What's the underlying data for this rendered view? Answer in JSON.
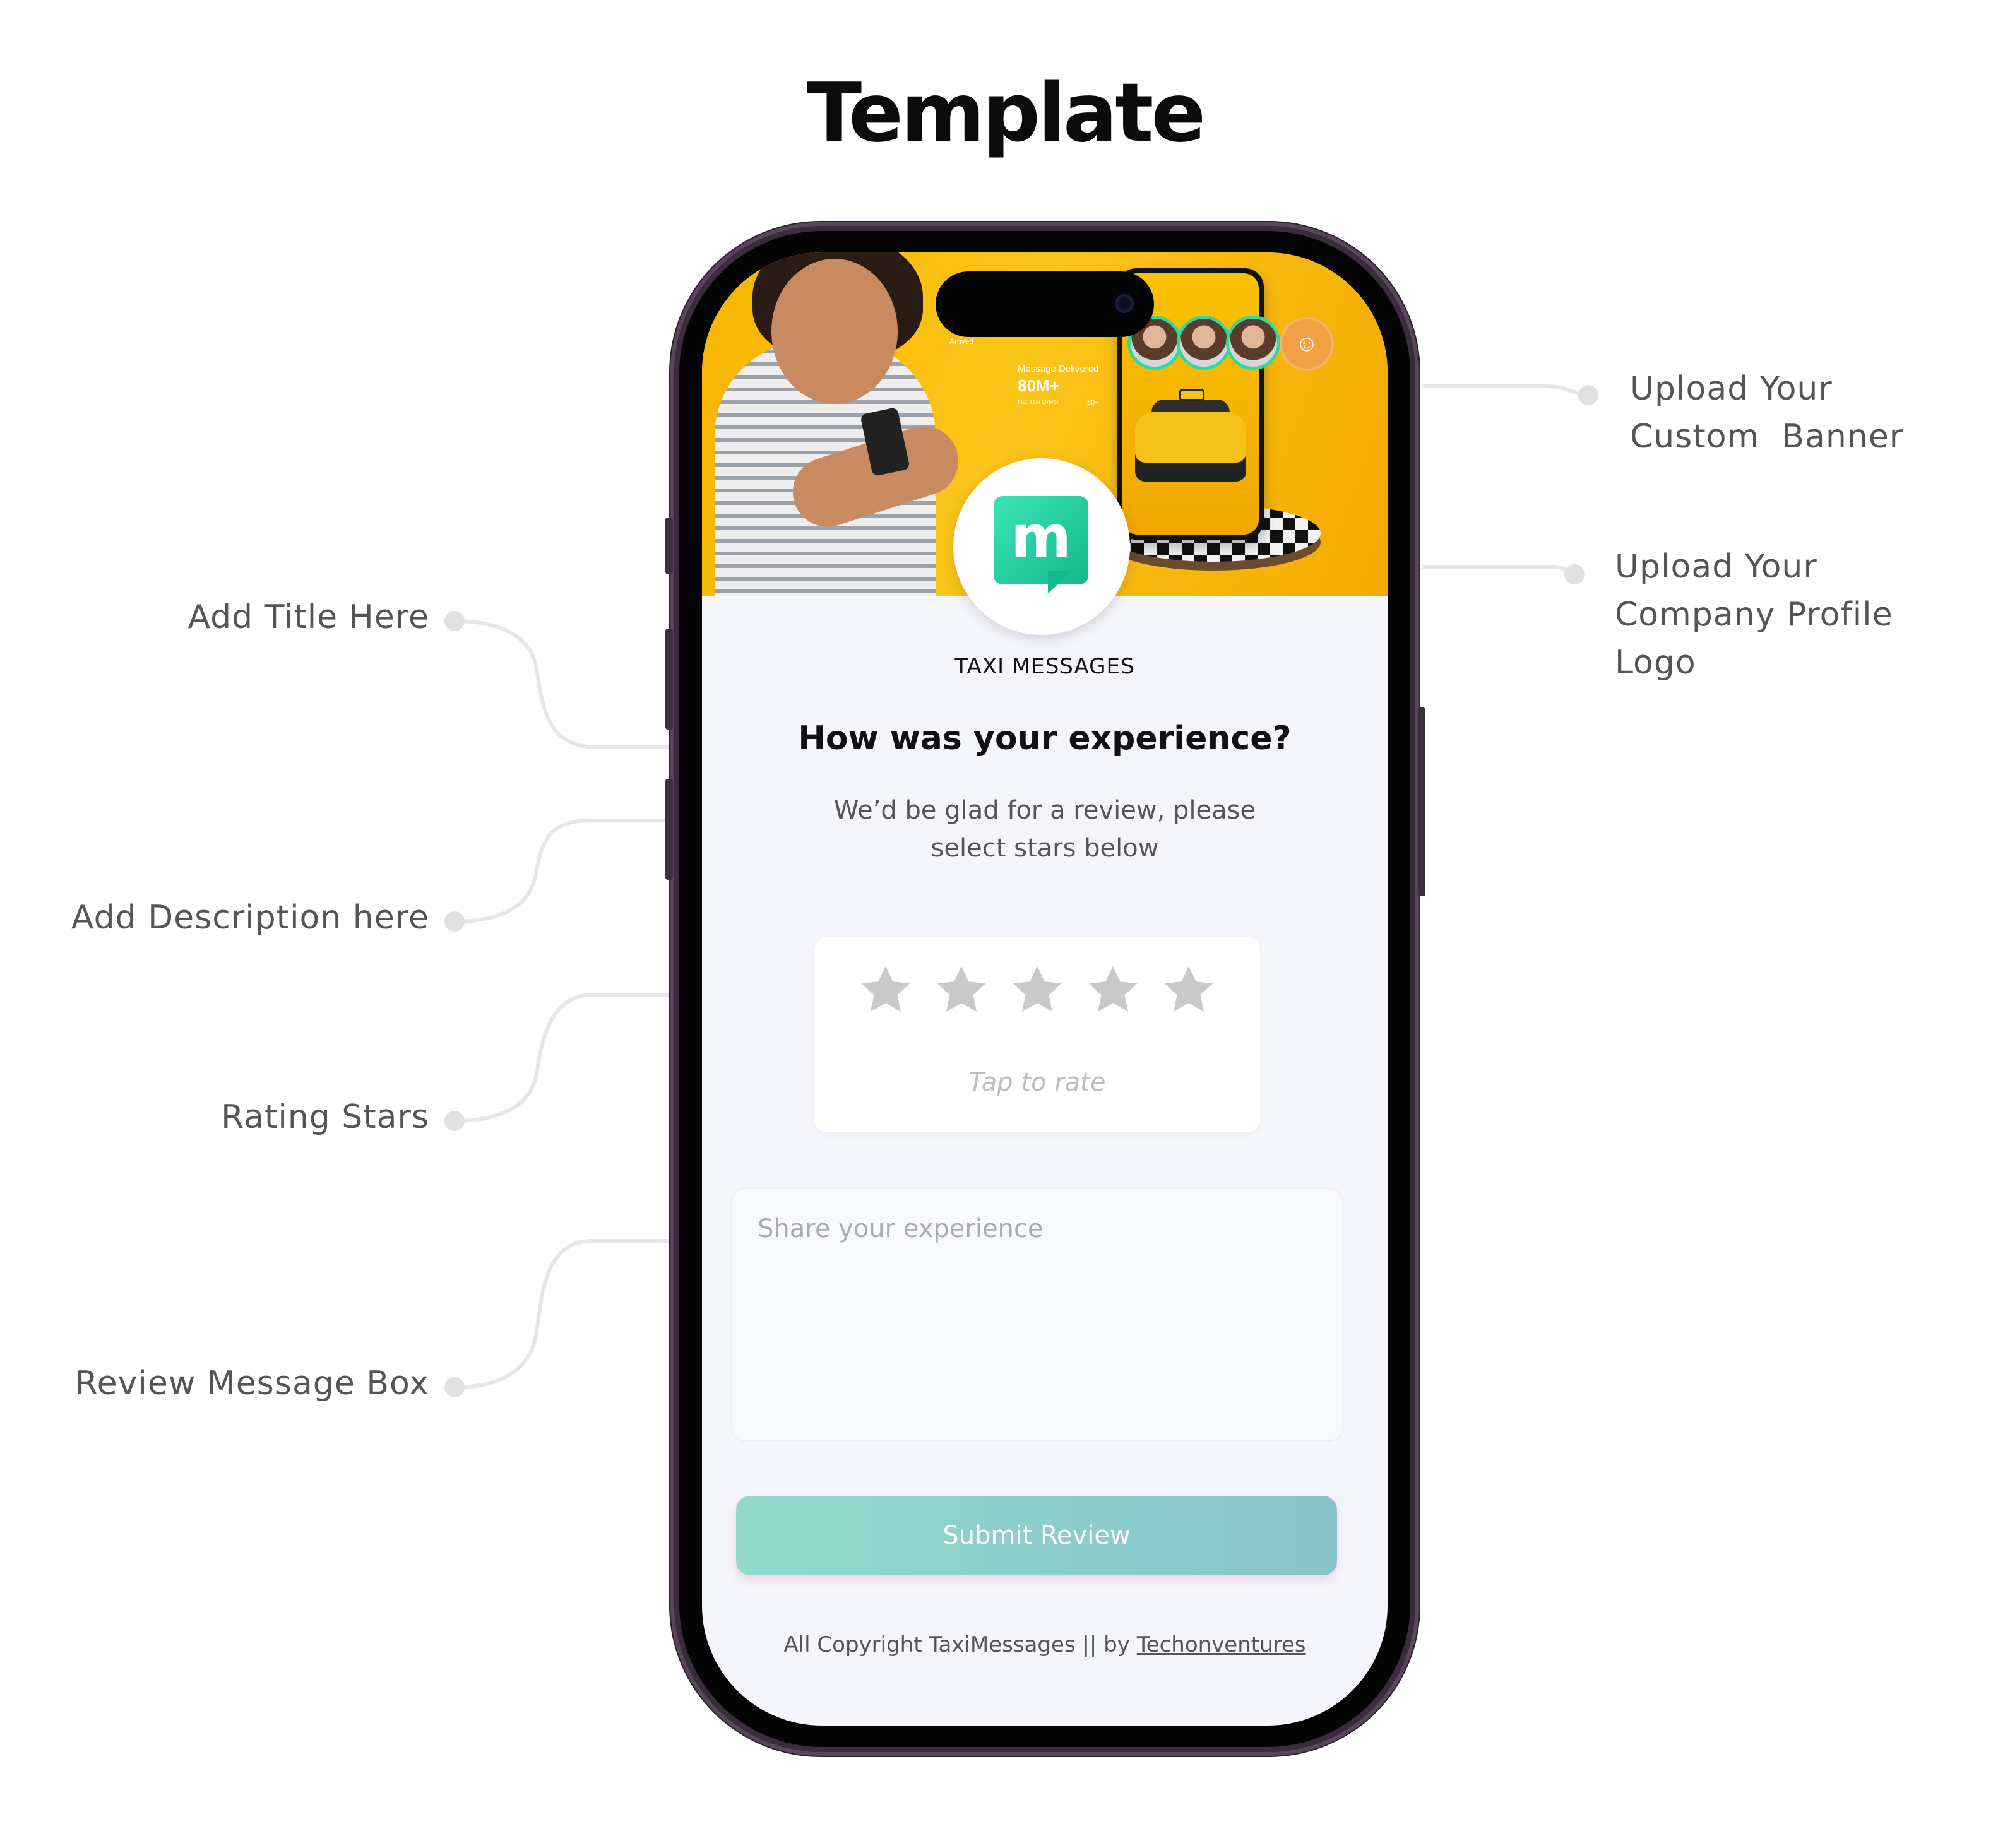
{
  "page_title": "Template",
  "annotations": {
    "banner": [
      "Upload Your",
      "Custom  Banner"
    ],
    "logo": [
      "Upload Your",
      "Company Profile",
      "Logo"
    ],
    "title": "Add Title Here",
    "description": "Add Description here",
    "rating": "Rating Stars",
    "review_box": "Review Message Box"
  },
  "banner": {
    "stat_label_top": "Arrived",
    "stat_caption": "Message Delivered",
    "stat_value": "80M+",
    "stat_sub": "No. Taxi Driver",
    "stat_sub_value": "80+",
    "taxi_plate": "TAXI"
  },
  "icons": {
    "logo": "tm-chat-logo",
    "rating": "star-icon",
    "banner_action": "users-icon"
  },
  "logo_text": "m",
  "company_name": "TAXI MESSAGES",
  "headline": "How was your experience?",
  "description": [
    "We’d be glad for a review, please",
    "select stars below"
  ],
  "rating": {
    "value": 0,
    "max": 5,
    "hint": "Tap to rate"
  },
  "review": {
    "placeholder": "Share your experience",
    "value": ""
  },
  "submit_label": "Submit Review",
  "footer": {
    "text": "All Copyright TaxiMessages || by ",
    "link": "Techonventures"
  },
  "colors": {
    "banner": "#f7b500",
    "logo_accent": "#1fcf9e",
    "button_gradient_start": "#90dacb",
    "button_gradient_end": "#89c3cb",
    "star_inactive": "#c9c9c9",
    "screen_bg": "#f4f6fc"
  }
}
